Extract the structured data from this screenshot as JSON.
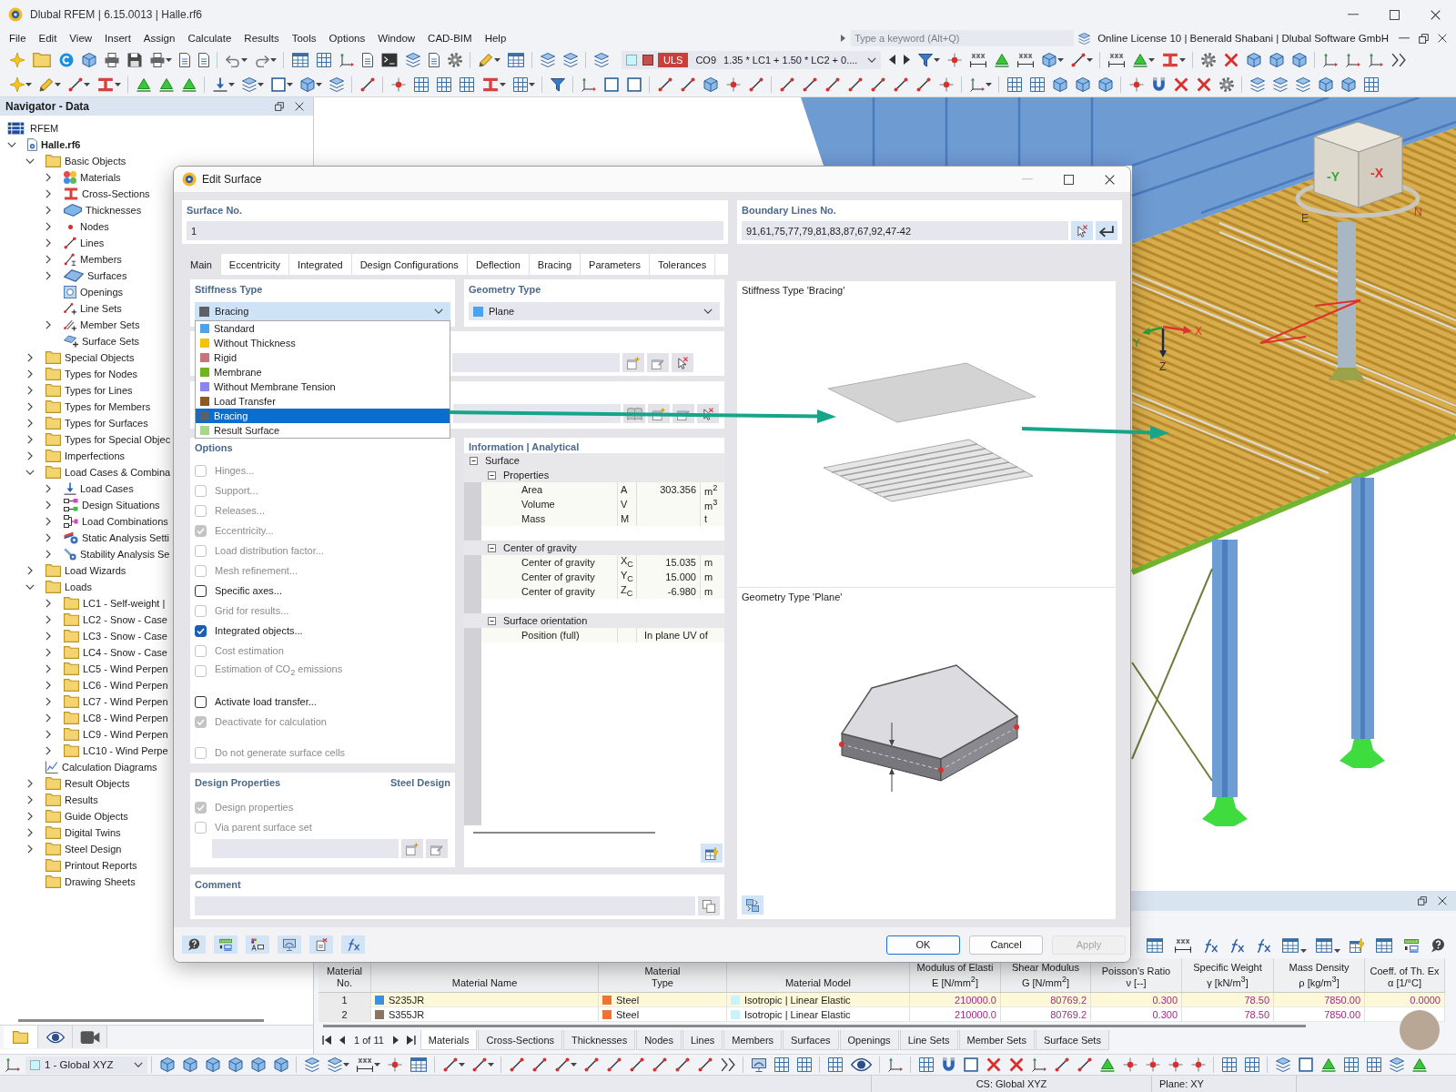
{
  "window": {
    "title": "Dlubal RFEM | 6.15.0013 | Halle.rf6"
  },
  "menu": [
    "File",
    "Edit",
    "View",
    "Insert",
    "Assign",
    "Calculate",
    "Results",
    "Tools",
    "Options",
    "Window",
    "CAD-BIM",
    "Help"
  ],
  "search": {
    "placeholder": "Type a keyword (Alt+Q)"
  },
  "license": "Online License 10 | Benerald Shabani | Dlubal Software GmbH",
  "toolbar": {
    "design_situation": "ULS",
    "combination": "CO9",
    "formula": "1.35 * LC1 + 1.50 * LC2 + 0...."
  },
  "navigator": {
    "title": "Navigator - Data",
    "tree": [
      {
        "label": "RFEM",
        "kind": "app",
        "children": [
          {
            "label": "Halle.rf6",
            "kind": "file",
            "expanded": true,
            "children": [
              {
                "label": "Basic Objects",
                "kind": "folder",
                "expanded": true,
                "children": [
                  {
                    "label": "Materials",
                    "kind": "material",
                    "expanded": false
                  },
                  {
                    "label": "Cross-Sections",
                    "kind": "section",
                    "expanded": false
                  },
                  {
                    "label": "Thicknesses",
                    "kind": "thickness",
                    "expanded": false
                  },
                  {
                    "label": "Nodes",
                    "kind": "node",
                    "expanded": false
                  },
                  {
                    "label": "Lines",
                    "kind": "line",
                    "expanded": false
                  },
                  {
                    "label": "Members",
                    "kind": "member",
                    "expanded": false
                  },
                  {
                    "label": "Surfaces",
                    "kind": "surface",
                    "expanded": false
                  },
                  {
                    "label": "Openings",
                    "kind": "opening"
                  },
                  {
                    "label": "Line Sets",
                    "kind": "lineset"
                  },
                  {
                    "label": "Member Sets",
                    "kind": "memberset",
                    "expanded": false
                  },
                  {
                    "label": "Surface Sets",
                    "kind": "surfaceset"
                  }
                ]
              },
              {
                "label": "Special Objects",
                "kind": "folder",
                "expanded": false
              },
              {
                "label": "Types for Nodes",
                "kind": "folder",
                "expanded": false
              },
              {
                "label": "Types for Lines",
                "kind": "folder",
                "expanded": false
              },
              {
                "label": "Types for Members",
                "kind": "folder",
                "expanded": false
              },
              {
                "label": "Types for Surfaces",
                "kind": "folder",
                "expanded": false
              },
              {
                "label": "Types for Special Objec",
                "kind": "folder",
                "expanded": false
              },
              {
                "label": "Imperfections",
                "kind": "folder",
                "expanded": false
              },
              {
                "label": "Load Cases & Combina",
                "kind": "folder",
                "expanded": true,
                "children": [
                  {
                    "label": "Load Cases",
                    "kind": "loadcase",
                    "expanded": false
                  },
                  {
                    "label": "Design Situations",
                    "kind": "situation",
                    "expanded": false
                  },
                  {
                    "label": "Load Combinations",
                    "kind": "combination",
                    "expanded": false
                  },
                  {
                    "label": "Static Analysis Setti",
                    "kind": "settings",
                    "expanded": false
                  },
                  {
                    "label": "Stability Analysis Se",
                    "kind": "stability",
                    "expanded": false
                  }
                ]
              },
              {
                "label": "Load Wizards",
                "kind": "folder",
                "expanded": false
              },
              {
                "label": "Loads",
                "kind": "folder",
                "expanded": true,
                "children": [
                  {
                    "label": "LC1 - Self-weight |",
                    "kind": "folder",
                    "expanded": false
                  },
                  {
                    "label": "LC2 - Snow - Case",
                    "kind": "folder",
                    "expanded": false
                  },
                  {
                    "label": "LC3 - Snow - Case",
                    "kind": "folder",
                    "expanded": false
                  },
                  {
                    "label": "LC4 - Snow - Case",
                    "kind": "folder",
                    "expanded": false
                  },
                  {
                    "label": "LC5 - Wind Perpen",
                    "kind": "folder",
                    "expanded": false
                  },
                  {
                    "label": "LC6 - Wind Perpen",
                    "kind": "folder",
                    "expanded": false
                  },
                  {
                    "label": "LC7 - Wind Perpen",
                    "kind": "folder",
                    "expanded": false
                  },
                  {
                    "label": "LC8 - Wind Perpen",
                    "kind": "folder",
                    "expanded": false
                  },
                  {
                    "label": "LC9 - Wind Perpen",
                    "kind": "folder",
                    "expanded": false
                  },
                  {
                    "label": "LC10 - Wind Perpe",
                    "kind": "folder",
                    "expanded": false
                  }
                ]
              },
              {
                "label": "Calculation Diagrams",
                "kind": "diagram"
              },
              {
                "label": "Result Objects",
                "kind": "folder",
                "expanded": false
              },
              {
                "label": "Results",
                "kind": "folder",
                "expanded": false
              },
              {
                "label": "Guide Objects",
                "kind": "folder",
                "expanded": false
              },
              {
                "label": "Digital Twins",
                "kind": "folder",
                "expanded": false
              },
              {
                "label": "Steel Design",
                "kind": "folder",
                "expanded": false
              },
              {
                "label": "Printout Reports",
                "kind": "folder"
              },
              {
                "label": "Drawing Sheets",
                "kind": "folder"
              }
            ]
          }
        ]
      }
    ],
    "view_tabs": [
      {
        "selected": true
      },
      {
        "selected": false
      },
      {
        "selected": false
      }
    ]
  },
  "view": {
    "axis_labels": [
      "X",
      "Y",
      "Z"
    ],
    "cube_labels": [
      "-Y",
      "-X"
    ],
    "compass_labels": [
      "E",
      "N"
    ]
  },
  "dialog": {
    "title": "Edit Surface",
    "surface_no": {
      "label": "Surface No.",
      "value": "1"
    },
    "boundary_lines": {
      "label": "Boundary Lines No.",
      "value": "91,61,75,77,79,81,83,87,67,92,47-42"
    },
    "tabs": [
      {
        "label": "Main",
        "selected": true
      },
      {
        "label": "Eccentricity",
        "selected": false
      },
      {
        "label": "Integrated",
        "selected": false
      },
      {
        "label": "Design Configurations",
        "selected": false
      },
      {
        "label": "Deflection",
        "selected": false
      },
      {
        "label": "Bracing",
        "selected": false
      },
      {
        "label": "Parameters",
        "selected": false
      },
      {
        "label": "Tolerances",
        "selected": false
      }
    ],
    "stiffness_type": {
      "label": "Stiffness Type",
      "value": "Bracing",
      "color": "#5f5f66",
      "expanded": true,
      "options": [
        {
          "label": "Standard",
          "color": "#4aa3f0",
          "selected": false
        },
        {
          "label": "Without Thickness",
          "color": "#f5c400",
          "selected": false
        },
        {
          "label": "Rigid",
          "color": "#c7757a",
          "selected": false
        },
        {
          "label": "Membrane",
          "color": "#6fb51d",
          "selected": false
        },
        {
          "label": "Without Membrane Tension",
          "color": "#8c84f5",
          "selected": false
        },
        {
          "label": "Load Transfer",
          "color": "#8e5a23",
          "selected": false
        },
        {
          "label": "Bracing",
          "color": "#5f5f66",
          "selected": true
        },
        {
          "label": "Result Surface",
          "color": "#a8d68a",
          "selected": false
        }
      ]
    },
    "geometry_type": {
      "label": "Geometry Type",
      "value": "Plane",
      "color": "#4aa3f0"
    },
    "options": {
      "label": "Options",
      "groups": [
        {
          "items": [
            {
              "label": "Hinges...",
              "checked": false,
              "disabled": true
            },
            {
              "label": "Support...",
              "checked": false,
              "disabled": true
            },
            {
              "label": "Releases...",
              "checked": false,
              "disabled": true
            },
            {
              "label": "Eccentricity...",
              "checked": true,
              "disabled": true
            },
            {
              "label": "Load distribution factor...",
              "checked": false,
              "disabled": true
            },
            {
              "label": "Mesh refinement...",
              "checked": false,
              "disabled": true
            },
            {
              "label": "Specific axes...",
              "checked": false,
              "disabled": false
            },
            {
              "label": "Grid for results...",
              "checked": false,
              "disabled": true
            },
            {
              "label": "Integrated objects...",
              "checked": true,
              "disabled": false
            },
            {
              "label": "Cost estimation",
              "checked": false,
              "disabled": true
            },
            {
              "label": "Estimation of CO$_{2}$ emissions",
              "checked": false,
              "disabled": true
            }
          ]
        },
        {
          "items": [
            {
              "label": "Activate load transfer...",
              "checked": false,
              "disabled": false
            },
            {
              "label": "Deactivate for calculation",
              "checked": true,
              "disabled": true
            }
          ]
        },
        {
          "items": [
            {
              "label": "Do not generate surface cells",
              "checked": false,
              "disabled": true
            }
          ]
        }
      ]
    },
    "design_properties": {
      "label": "Design Properties",
      "addon": "Steel Design",
      "items": [
        {
          "label": "Design properties",
          "checked": true,
          "disabled": true
        },
        {
          "label": "Via parent surface set",
          "checked": false,
          "disabled": true
        }
      ]
    },
    "information": {
      "label": "Information | Analytical",
      "tree": [
        {
          "label": "Surface",
          "expanded": true,
          "children": [
            {
              "label": "Properties",
              "expanded": true,
              "children": [
                {
                  "label": "Area",
                  "symbol": "A",
                  "value": "303.356",
                  "unit": "m$^{2}$"
                },
                {
                  "label": "Volume",
                  "symbol": "V",
                  "unit": "m$^{3}$"
                },
                {
                  "label": "Mass",
                  "symbol": "M",
                  "unit": "t"
                }
              ]
            },
            {
              "label": "Center of gravity",
              "expanded": true,
              "children": [
                {
                  "label": "Center of gravity",
                  "symbol": "X$_{C}$",
                  "value": "15.035",
                  "unit": "m"
                },
                {
                  "label": "Center of gravity",
                  "symbol": "Y$_{C}$",
                  "value": "15.000",
                  "unit": "m"
                },
                {
                  "label": "Center of gravity",
                  "symbol": "Z$_{C}$",
                  "value": "-6.980",
                  "unit": "m"
                }
              ]
            },
            {
              "label": "Surface orientation",
              "expanded": true,
              "children": [
                {
                  "label": "Position (full)",
                  "value": "In plane UV of"
                }
              ]
            }
          ]
        }
      ]
    },
    "comment": {
      "label": "Comment"
    },
    "preview": {
      "stiffness_caption": "Stiffness Type 'Bracing'",
      "geometry_caption": "Geometry Type 'Plane'"
    },
    "buttons": [
      {
        "label": "OK",
        "default": true,
        "disabled": false
      },
      {
        "label": "Cancel",
        "default": false,
        "disabled": false
      },
      {
        "label": "Apply",
        "default": false,
        "disabled": true
      }
    ]
  },
  "table": {
    "columns": [
      {
        "lines": [
          "Material",
          "No."
        ]
      },
      {
        "lines": [
          "Material Name"
        ]
      },
      {
        "lines": [
          "Material",
          "Type"
        ]
      },
      {
        "lines": [
          "Material Model"
        ]
      },
      {
        "lines": [
          "Modulus of Elasti",
          "E [N/mm$^{2}$]"
        ]
      },
      {
        "lines": [
          "Shear Modulus",
          "G [N/mm$^{2}$]"
        ]
      },
      {
        "lines": [
          "Poisson's Ratio",
          "ν [--]"
        ]
      },
      {
        "lines": [
          "Specific Weight",
          "γ [kN/m$^{3}$]"
        ]
      },
      {
        "lines": [
          "Mass Density",
          "ρ [kg/m$^{3}$]"
        ]
      },
      {
        "lines": [
          "Coeff. of Th. Ex",
          "α [1/°C]"
        ]
      }
    ],
    "rows": [
      {
        "selected": true,
        "cells": [
          {
            "text": "1"
          },
          {
            "text": "S235JR",
            "color": "#3d8fe0"
          },
          {
            "text": "Steel",
            "color": "#ee7433"
          },
          {
            "text": "Isotropic | Linear Elastic",
            "color": "#c9f3f7"
          },
          {
            "text": "210000.0"
          },
          {
            "text": "80769.2"
          },
          {
            "text": "0.300"
          },
          {
            "text": "78.50"
          },
          {
            "text": "7850.00"
          },
          {
            "text": "0.0000"
          }
        ]
      },
      {
        "selected": false,
        "cells": [
          {
            "text": "2"
          },
          {
            "text": "S355JR",
            "color": "#8a7462"
          },
          {
            "text": "Steel",
            "color": "#ee7433"
          },
          {
            "text": "Isotropic | Linear Elastic",
            "color": "#c9f3f7"
          },
          {
            "text": "210000.0"
          },
          {
            "text": "80769.2"
          },
          {
            "text": "0.300"
          },
          {
            "text": "78.50"
          },
          {
            "text": "7850.00"
          }
        ]
      }
    ],
    "pager": "1 of 11",
    "tabs": [
      {
        "label": "Materials",
        "selected": true
      },
      {
        "label": "Cross-Sections",
        "selected": false
      },
      {
        "label": "Thicknesses",
        "selected": false
      },
      {
        "label": "Nodes",
        "selected": false
      },
      {
        "label": "Lines",
        "selected": false
      },
      {
        "label": "Members",
        "selected": false
      },
      {
        "label": "Surfaces",
        "selected": false
      },
      {
        "label": "Openings",
        "selected": false
      },
      {
        "label": "Line Sets",
        "selected": false
      },
      {
        "label": "Member Sets",
        "selected": false
      },
      {
        "label": "Surface Sets",
        "selected": false
      }
    ]
  },
  "bottom_toolbar": {
    "coordinate_system": "1 - Global XYZ"
  },
  "status_bar": {
    "coordinate_system": "CS: Global XYZ",
    "plane": "Plane: XY"
  }
}
